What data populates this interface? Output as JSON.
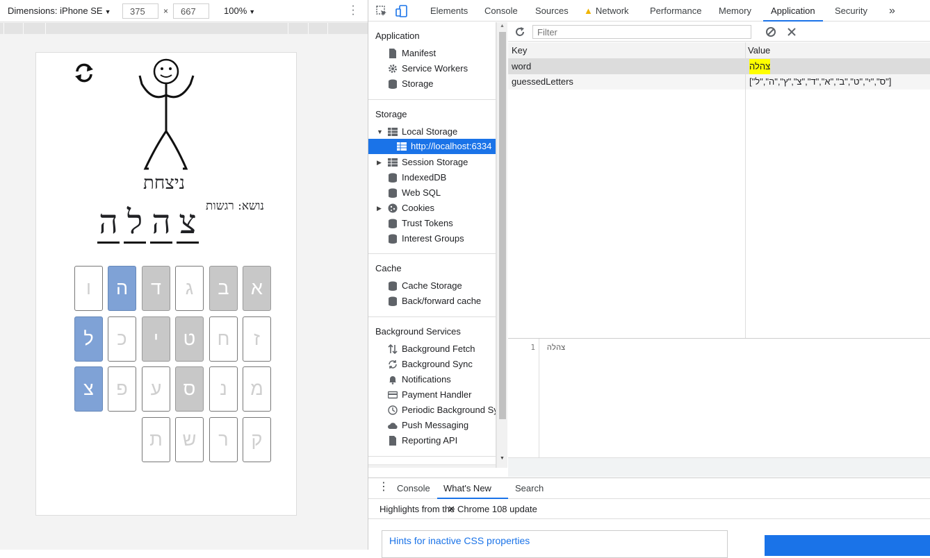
{
  "device_toolbar": {
    "dimensions_label": "Dimensions: iPhone SE",
    "width": "375",
    "height": "667",
    "times": "×",
    "zoom": "100%"
  },
  "game": {
    "result_text": "ניצחת",
    "topic": "נושא: רגשות",
    "word_letters": [
      "צ",
      "ה",
      "ל",
      "ה"
    ],
    "keyboard": [
      {
        "letter": "א",
        "state": "used"
      },
      {
        "letter": "ב",
        "state": "used"
      },
      {
        "letter": "ג",
        "state": "unused"
      },
      {
        "letter": "ד",
        "state": "used"
      },
      {
        "letter": "ה",
        "state": "hit"
      },
      {
        "letter": "ו",
        "state": "unused"
      },
      {
        "letter": "ז",
        "state": "unused"
      },
      {
        "letter": "ח",
        "state": "unused"
      },
      {
        "letter": "ט",
        "state": "used"
      },
      {
        "letter": "י",
        "state": "used"
      },
      {
        "letter": "כ",
        "state": "unused"
      },
      {
        "letter": "ל",
        "state": "hit"
      },
      {
        "letter": "מ",
        "state": "unused"
      },
      {
        "letter": "נ",
        "state": "unused"
      },
      {
        "letter": "ס",
        "state": "used"
      },
      {
        "letter": "ע",
        "state": "unused"
      },
      {
        "letter": "פ",
        "state": "unused"
      },
      {
        "letter": "צ",
        "state": "hit"
      },
      {
        "letter": "ק",
        "state": "unused"
      },
      {
        "letter": "ר",
        "state": "unused"
      },
      {
        "letter": "ש",
        "state": "unused"
      },
      {
        "letter": "ת",
        "state": "unused"
      }
    ]
  },
  "devtools": {
    "tabs": [
      "Elements",
      "Console",
      "Sources",
      "Network",
      "Performance",
      "Memory",
      "Application",
      "Security"
    ],
    "active_tab": "Application",
    "more": "»",
    "sidebar": {
      "application_header": "Application",
      "application_items": [
        "Manifest",
        "Service Workers",
        "Storage"
      ],
      "storage_header": "Storage",
      "storage_items": [
        "Local Storage",
        "http://localhost:6334",
        "Session Storage",
        "IndexedDB",
        "Web SQL",
        "Cookies",
        "Trust Tokens",
        "Interest Groups"
      ],
      "cache_header": "Cache",
      "cache_items": [
        "Cache Storage",
        "Back/forward cache"
      ],
      "bg_header": "Background Services",
      "bg_items": [
        "Background Fetch",
        "Background Sync",
        "Notifications",
        "Payment Handler",
        "Periodic Background Sy",
        "Push Messaging",
        "Reporting API"
      ]
    },
    "filter_placeholder": "Filter",
    "table": {
      "key_header": "Key",
      "value_header": "Value",
      "rows": [
        {
          "key": "word",
          "value": "צהלה"
        },
        {
          "key": "guessedLetters",
          "value": "[\"ס\",\"י\",\"ט\",\"ב\",\"א\",\"ד\",\"צ\",\"ץ\",\"ה\",\"ל\"]"
        }
      ]
    },
    "preview": {
      "line_number": "1",
      "content": "צהלה"
    },
    "drawer": {
      "tabs": [
        "Console",
        "What's New",
        "Search"
      ],
      "active": "What's New",
      "close": "✕",
      "highlights": "Highlights from the Chrome 108 update",
      "hint_title": "Hints for inactive CSS properties"
    }
  },
  "colors": {
    "accent": "#1a73e8",
    "hit_key": "#7fa2d6",
    "used_key": "#c8c8c8",
    "highlight": "#ffff00"
  }
}
